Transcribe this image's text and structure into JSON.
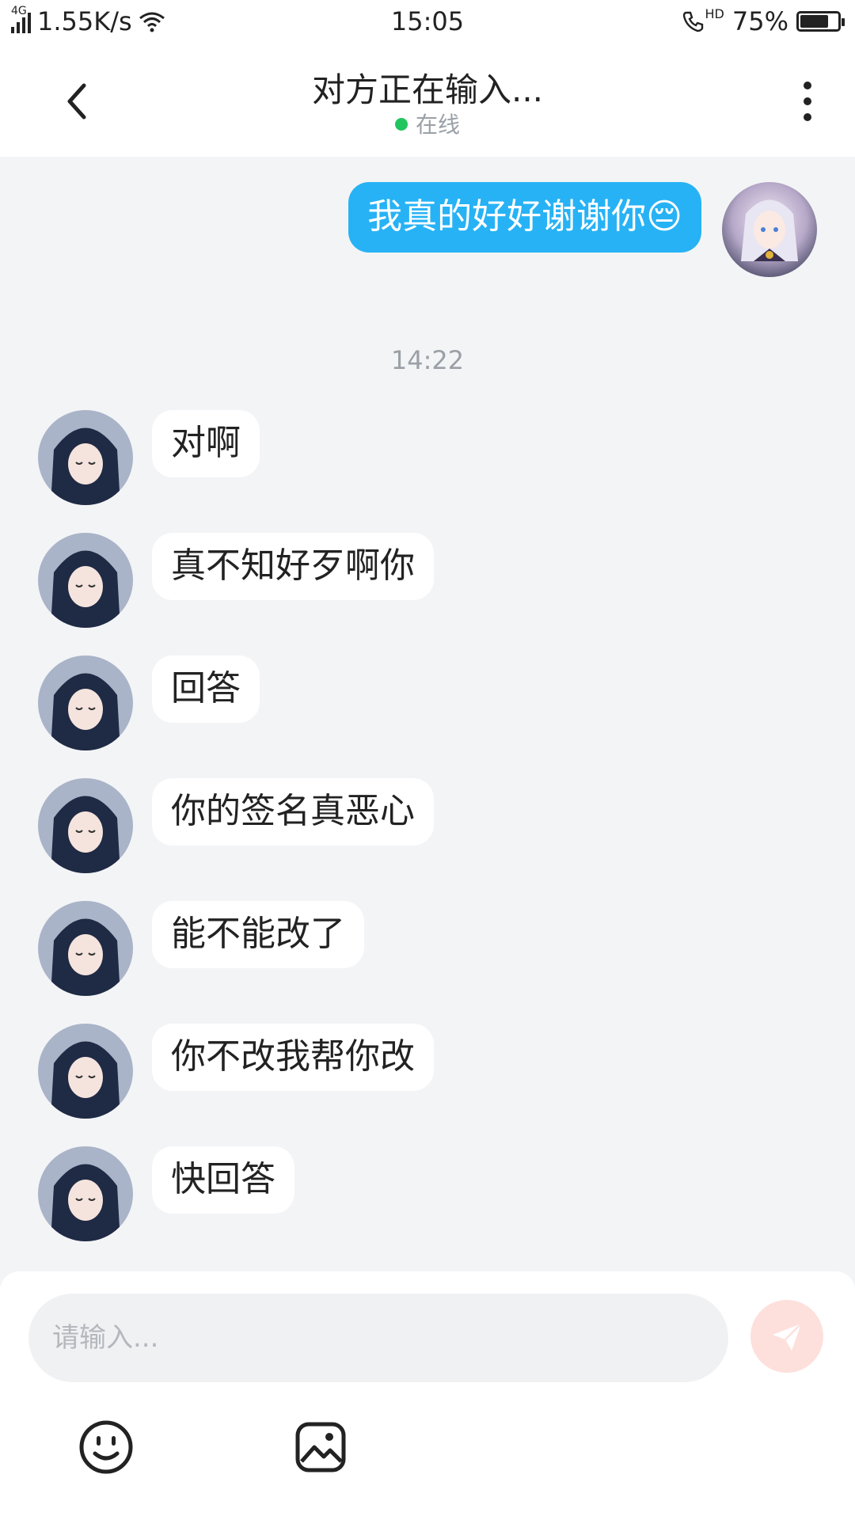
{
  "status_bar": {
    "network": "4G",
    "speed": "1.55K/s",
    "time": "15:05",
    "hd": "HD",
    "battery": "75%",
    "battery_level": 0.75
  },
  "header": {
    "title": "对方正在输入...",
    "presence": "在线"
  },
  "messages": {
    "outgoing_1": "我真的好好谢谢你😔",
    "time_divider": "14:22",
    "incoming": [
      "对啊",
      "真不知好歹啊你",
      "回答",
      "你的签名真恶心",
      "能不能改了",
      "你不改我帮你改",
      "快回答"
    ]
  },
  "composer": {
    "placeholder": "请输入..."
  },
  "icons": {
    "back": "back-arrow-icon",
    "more": "more-vertical-icon",
    "send": "send-icon",
    "emoji": "emoji-icon",
    "image": "image-icon"
  },
  "colors": {
    "outgoing_bubble": "#27b2f5",
    "presence_dot": "#22c55e",
    "send_button": "#fde0dc"
  }
}
